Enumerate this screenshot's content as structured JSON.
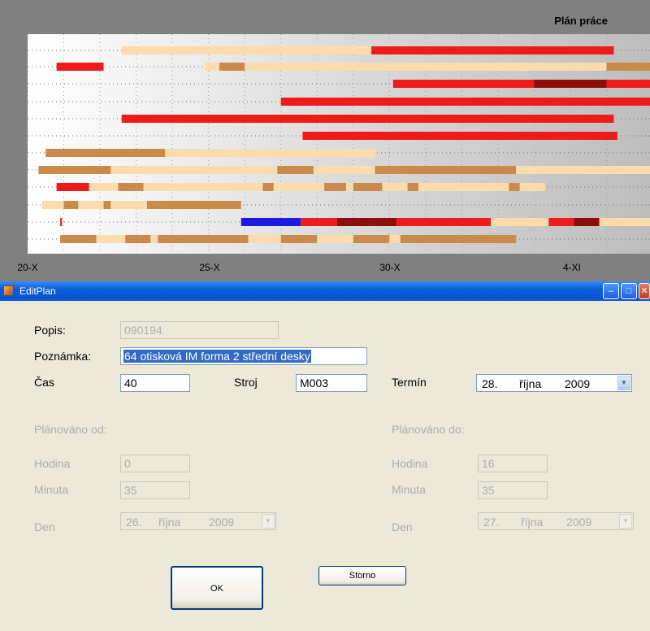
{
  "chart_data": {
    "type": "gantt",
    "title": "Plán práce",
    "x_ticks": [
      "20-X",
      "25-X",
      "30-X",
      "4-XI"
    ],
    "colors": {
      "light": "#fcdcab",
      "tan": "#c98a4c",
      "red": "#ee1b1b",
      "dark_red": "#8e0c0c",
      "blue": "#1a1ae0"
    },
    "rows": [
      [
        [
          "light",
          22.6,
          29.5
        ],
        [
          "red",
          29.5,
          36.2
        ]
      ],
      [
        [
          "red",
          20.8,
          22.1
        ],
        [
          "light",
          24.9,
          25.3
        ],
        [
          "tan",
          25.3,
          26.0
        ],
        [
          "light",
          26.0,
          36.0
        ],
        [
          "tan",
          36.0,
          37.2
        ]
      ],
      [
        [
          "red",
          30.1,
          34.0
        ],
        [
          "dark_red",
          34.0,
          36.0
        ],
        [
          "red",
          36.0,
          37.2
        ]
      ],
      [
        [
          "red",
          27.0,
          37.2
        ]
      ],
      [
        [
          "red",
          22.6,
          36.2
        ]
      ],
      [
        [
          "red",
          27.6,
          36.3
        ]
      ],
      [
        [
          "tan",
          20.5,
          23.8
        ],
        [
          "light",
          23.8,
          29.6
        ]
      ],
      [
        [
          "tan",
          20.3,
          22.3
        ],
        [
          "light",
          22.3,
          26.9
        ],
        [
          "tan",
          26.9,
          27.9
        ],
        [
          "light",
          27.9,
          29.6
        ],
        [
          "tan",
          29.6,
          33.5
        ],
        [
          "light",
          33.5,
          37.2
        ]
      ],
      [
        [
          "red",
          20.8,
          21.7
        ],
        [
          "light",
          21.7,
          22.5
        ],
        [
          "tan",
          22.5,
          23.2
        ],
        [
          "light",
          23.2,
          26.5
        ],
        [
          "tan",
          26.5,
          26.8
        ],
        [
          "light",
          26.8,
          28.2
        ],
        [
          "tan",
          28.2,
          28.8
        ],
        [
          "light",
          28.8,
          29.0
        ],
        [
          "tan",
          29.0,
          29.8
        ],
        [
          "light",
          29.8,
          30.5
        ],
        [
          "tan",
          30.5,
          30.8
        ],
        [
          "light",
          30.8,
          33.3
        ],
        [
          "tan",
          33.3,
          33.6
        ],
        [
          "light",
          33.6,
          34.3
        ]
      ],
      [
        [
          "light",
          20.4,
          21.0
        ],
        [
          "tan",
          21.0,
          21.4
        ],
        [
          "light",
          21.4,
          22.1
        ],
        [
          "tan",
          22.1,
          22.3
        ],
        [
          "light",
          22.3,
          23.3
        ],
        [
          "tan",
          23.3,
          25.9
        ]
      ],
      [
        [
          "red",
          20.9,
          20.95
        ],
        [
          "blue",
          25.9,
          27.55
        ],
        [
          "red",
          27.55,
          28.55
        ],
        [
          "dark_red",
          28.55,
          30.2
        ],
        [
          "red",
          30.2,
          32.8
        ],
        [
          "light",
          32.8,
          34.4
        ],
        [
          "red",
          34.4,
          35.1
        ],
        [
          "dark_red",
          35.1,
          35.8
        ],
        [
          "light",
          35.8,
          37.2
        ]
      ],
      [
        [
          "tan",
          20.9,
          21.9
        ],
        [
          "light",
          21.9,
          22.7
        ],
        [
          "tan",
          22.7,
          23.4
        ],
        [
          "light",
          23.4,
          23.6
        ],
        [
          "tan",
          23.6,
          26.1
        ],
        [
          "light",
          26.1,
          27.0
        ],
        [
          "tan",
          27.0,
          28.0
        ],
        [
          "light",
          28.0,
          29.0
        ],
        [
          "tan",
          29.0,
          30.0
        ],
        [
          "light",
          30.0,
          30.3
        ],
        [
          "tan",
          30.3,
          33.5
        ]
      ]
    ]
  },
  "window": {
    "title": "EditPlan"
  },
  "form": {
    "popis_label": "Popis:",
    "popis_value": "090194",
    "poznamka_label": "Poznámka:",
    "poznamka_value": "64 otisková IM forma 2 střední desky",
    "cas_label": "Čas",
    "cas_value": "40",
    "stroj_label": "Stroj",
    "stroj_value": "M003",
    "termin_label": "Termín",
    "termin_day": "28.",
    "termin_month": "října",
    "termin_year": "2009",
    "planovano_od_label": "Plánováno od:",
    "planovano_do_label": "Plánováno do:",
    "hodina_label": "Hodina",
    "minuta_label": "Minuta",
    "den_label": "Den",
    "od_hodina": "0",
    "od_minuta": "35",
    "od_den_day": "26.",
    "od_den_month": "října",
    "od_den_year": "2009",
    "do_hodina": "16",
    "do_minuta": "35",
    "do_den_day": "27.",
    "do_den_month": "října",
    "do_den_year": "2009"
  },
  "buttons": {
    "ok": "OK",
    "storno": "Storno"
  }
}
